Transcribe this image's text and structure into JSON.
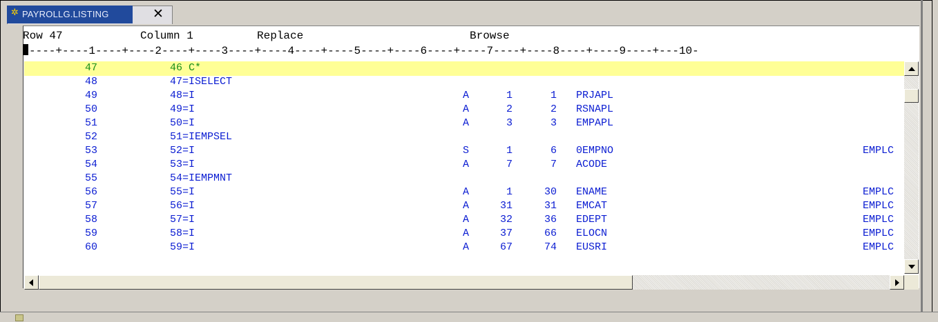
{
  "tab": {
    "title": "PAYROLLG.LISTING",
    "icon": "gear-bug-icon",
    "close_glyph": "✕",
    "active_color": "#214a9c"
  },
  "status": {
    "row": "Row 47",
    "column": "Column 1",
    "mode": "Replace",
    "view": "Browse"
  },
  "ruler": "----+----1----+----2----+----3----+----4----+----5----+----6----+----7----+----8----+----9----+---10-",
  "colors": {
    "text": "#0a1cd2",
    "current_line_text": "#1a8f1a",
    "current_line_bg": "#ffff96"
  },
  "rows": [
    {
      "seq": "47",
      "src": "46 C*",
      "t": "",
      "from": "",
      "to": "",
      "name": "",
      "file": "",
      "current": true
    },
    {
      "seq": "48",
      "src": "47=ISELECT",
      "t": "",
      "from": "",
      "to": "",
      "name": "",
      "file": ""
    },
    {
      "seq": "49",
      "src": "48=I",
      "t": "A",
      "from": "1",
      "to": "1",
      "name": "PRJAPL",
      "file": ""
    },
    {
      "seq": "50",
      "src": "49=I",
      "t": "A",
      "from": "2",
      "to": "2",
      "name": "RSNAPL",
      "file": ""
    },
    {
      "seq": "51",
      "src": "50=I",
      "t": "A",
      "from": "3",
      "to": "3",
      "name": "EMPAPL",
      "file": ""
    },
    {
      "seq": "52",
      "src": "51=IEMPSEL",
      "t": "",
      "from": "",
      "to": "",
      "name": "",
      "file": ""
    },
    {
      "seq": "53",
      "src": "52=I",
      "t": "S",
      "from": "1",
      "to": "6",
      "name": "0EMPNO",
      "file": "EMPLC"
    },
    {
      "seq": "54",
      "src": "53=I",
      "t": "A",
      "from": "7",
      "to": "7",
      "name": "ACODE",
      "file": ""
    },
    {
      "seq": "55",
      "src": "54=IEMPMNT",
      "t": "",
      "from": "",
      "to": "",
      "name": "",
      "file": ""
    },
    {
      "seq": "56",
      "src": "55=I",
      "t": "A",
      "from": "1",
      "to": "30",
      "name": "ENAME",
      "file": "EMPLC"
    },
    {
      "seq": "57",
      "src": "56=I",
      "t": "A",
      "from": "31",
      "to": "31",
      "name": "EMCAT",
      "file": "EMPLC"
    },
    {
      "seq": "58",
      "src": "57=I",
      "t": "A",
      "from": "32",
      "to": "36",
      "name": "EDEPT",
      "file": "EMPLC"
    },
    {
      "seq": "59",
      "src": "58=I",
      "t": "A",
      "from": "37",
      "to": "66",
      "name": "ELOCN",
      "file": "EMPLC"
    },
    {
      "seq": "60",
      "src": "59=I",
      "t": "A",
      "from": "67",
      "to": "74",
      "name": "EUSRI",
      "file": "EMPLC"
    }
  ]
}
